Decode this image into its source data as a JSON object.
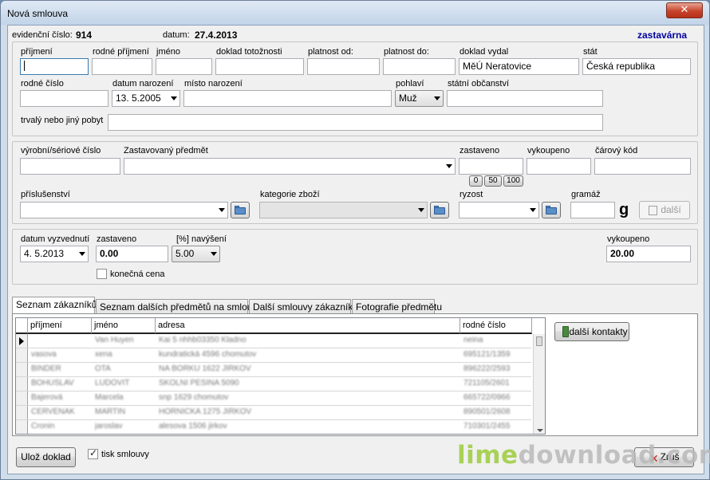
{
  "window": {
    "title": "Nová smlouva",
    "close_label": "✕"
  },
  "header": {
    "evidencni_label": "evidenční číslo:",
    "evidencni_value": "914",
    "datum_label": "datum:",
    "datum_value": "27.4.2013",
    "status": "zastavárna"
  },
  "person": {
    "prijmeni_label": "příjmení",
    "rodne_prijmeni_label": "rodné příjmení",
    "jmeno_label": "jméno",
    "doklad_label": "doklad totožnosti",
    "platnost_od_label": "platnost od:",
    "platnost_do_label": "platnost do:",
    "doklad_vydal_label": "doklad vydal",
    "doklad_vydal_value": "MěÚ Neratovice",
    "stat_label": "stát",
    "stat_value": "Česká republika",
    "rodne_cislo_label": "rodné číslo",
    "datum_narozeni_label": "datum narození",
    "datum_narozeni_value": "13. 5.2005",
    "misto_narozeni_label": "místo narození",
    "pohlavi_label": "pohlaví",
    "pohlavi_value": "Muž",
    "obcanstvi_label": "státní občanství",
    "pobyt_label": "trvalý nebo jiný pobyt"
  },
  "item": {
    "seriove_label": "výrobní/sériové číslo",
    "predmet_label": "Zastavovaný předmět",
    "zastaveno_label": "zastaveno",
    "vykoupeno_label": "vykoupeno",
    "carovy_label": "čárový kód",
    "quick_0": "0",
    "quick_50": "50",
    "quick_100": "100",
    "prislusenstvi_label": "příslušenství",
    "kategorie_label": "kategorie zboží",
    "ryzost_label": "ryzost",
    "gramaz_label": "gramáž",
    "gram_unit": "g",
    "dalsi_label": "další"
  },
  "terms": {
    "vyzvednuti_label": "datum vyzvednutí",
    "vyzvednuti_value": "4. 5.2013",
    "zastaveno_label": "zastaveno",
    "zastaveno_value": "0.00",
    "navyseni_label": "[%] navýšení",
    "navyseni_value": "5.00",
    "vykoupeno_label": "vykoupeno",
    "vykoupeno_value": "20.00",
    "konecna_label": "konečná cena"
  },
  "tabs": [
    {
      "label": "Seznam zákazníků"
    },
    {
      "label": "Seznam dalších předmětů na smlouvě"
    },
    {
      "label": "Další smlouvy zákazníka"
    },
    {
      "label": "Fotografie předmětu"
    }
  ],
  "grid": {
    "columns": [
      "příjmení",
      "jméno",
      "adresa",
      "rodné číslo"
    ],
    "rows": [
      [
        "",
        "Van Huyen",
        "Kai 5 nhhb03350 Kladno",
        "neina"
      ],
      [
        "vasova",
        "xena",
        "kundratická 4596 chomutov",
        "695121/1359"
      ],
      [
        "BINDER",
        "OTA",
        "NA BORKU 1622 JIRKOV",
        "896222/2593"
      ],
      [
        "BOHUSLAV",
        "LUDOVIT",
        "SKOLNI PESINA 5090",
        "721105/2601"
      ],
      [
        "Bajerová",
        "Marcela",
        "snp 1629 chomutov",
        "665722/0966"
      ],
      [
        "CERVENAK",
        "MARTIN",
        "HORNICKA 1275 JIRKOV",
        "890501/2608"
      ],
      [
        "Cronin",
        "jaroslav",
        "alesova 1506 jirkov",
        "710301/2455"
      ]
    ],
    "dalsi_kontakty": "další kontakty"
  },
  "footer": {
    "uloz_label": "Ulož doklad",
    "tisk_label": "tisk smlouvy",
    "zrus_label": "Zruš"
  },
  "watermark": {
    "part1": "lime",
    "part2": "download",
    "part3": ".com"
  },
  "colors": {
    "accent": "#0000a0",
    "watermark_green": "#9ccc3c",
    "watermark_grey": "#b9b9b9"
  }
}
